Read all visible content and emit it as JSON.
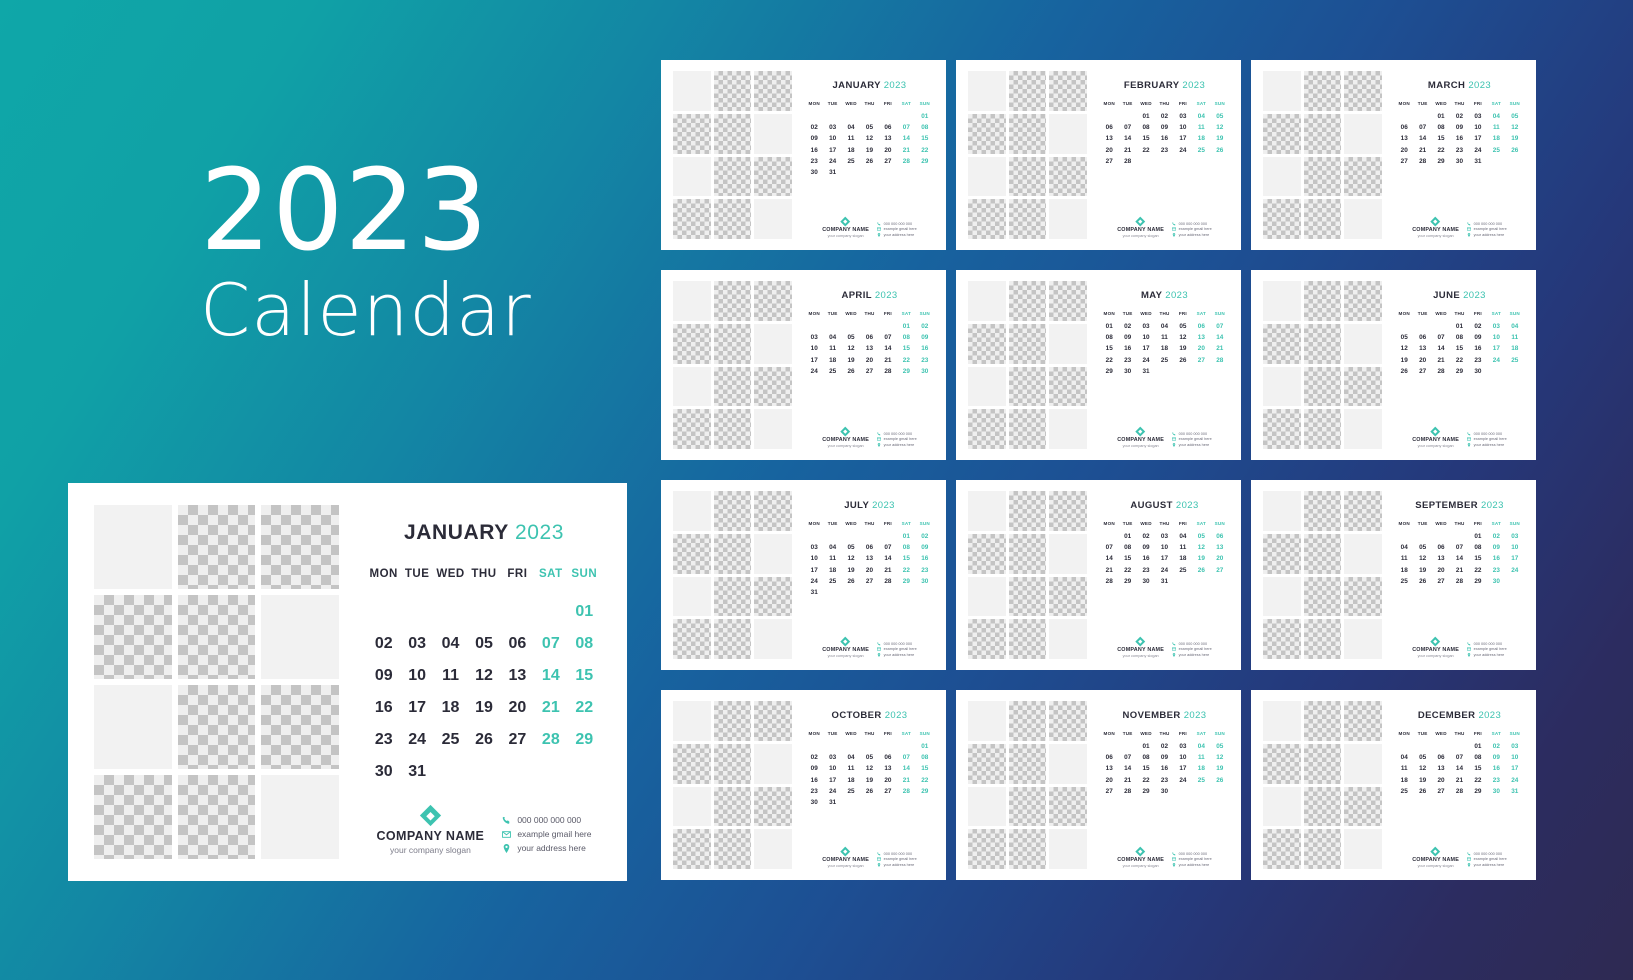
{
  "hero": {
    "year": "2023",
    "word": "Calendar"
  },
  "theme": {
    "accent": "#3dc3b0",
    "text_dark": "#2b2b38",
    "bg_from": "#0fa7a8",
    "bg_to": "#2e2a52",
    "card_bg": "#ffffff"
  },
  "weekdays": [
    "MON",
    "TUE",
    "WED",
    "THU",
    "FRI",
    "SAT",
    "SUN"
  ],
  "footer": {
    "company_name": "COMPANY NAME",
    "slogan": "your company slogan",
    "phone": "000 000 000 000",
    "email": "example gmail here",
    "address": "your  address here",
    "icons": [
      "phone-icon",
      "envelope-icon",
      "location-pin-icon"
    ],
    "logo_icon": "diamond-logo-icon"
  },
  "featured": {
    "month": "JANUARY",
    "year": "2023",
    "lead_blanks": 6,
    "days": 31
  },
  "months": [
    {
      "month": "JANUARY",
      "year": "2023",
      "lead_blanks": 6,
      "days": 31
    },
    {
      "month": "FEBRUARY",
      "year": "2023",
      "lead_blanks": 2,
      "days": 28
    },
    {
      "month": "MARCH",
      "year": "2023",
      "lead_blanks": 2,
      "days": 31
    },
    {
      "month": "APRIL",
      "year": "2023",
      "lead_blanks": 5,
      "days": 30
    },
    {
      "month": "MAY",
      "year": "2023",
      "lead_blanks": 0,
      "days": 31
    },
    {
      "month": "JUNE",
      "year": "2023",
      "lead_blanks": 3,
      "days": 30
    },
    {
      "month": "JULY",
      "year": "2023",
      "lead_blanks": 5,
      "days": 31
    },
    {
      "month": "AUGUST",
      "year": "2023",
      "lead_blanks": 1,
      "days": 31
    },
    {
      "month": "SEPTEMBER",
      "year": "2023",
      "lead_blanks": 4,
      "days": 30
    },
    {
      "month": "OCTOBER",
      "year": "2023",
      "lead_blanks": 6,
      "days": 31
    },
    {
      "month": "NOVEMBER",
      "year": "2023",
      "lead_blanks": 2,
      "days": 30
    },
    {
      "month": "DECEMBER",
      "year": "2023",
      "lead_blanks": 4,
      "days": 31
    }
  ],
  "photo_grid": {
    "note": "12 placeholder cells per card, 3 columns x 4 rows",
    "pattern": [
      "plain",
      "checker",
      "checker",
      "checker",
      "checker",
      "plain",
      "plain",
      "checker",
      "checker",
      "checker",
      "checker",
      "plain"
    ]
  }
}
